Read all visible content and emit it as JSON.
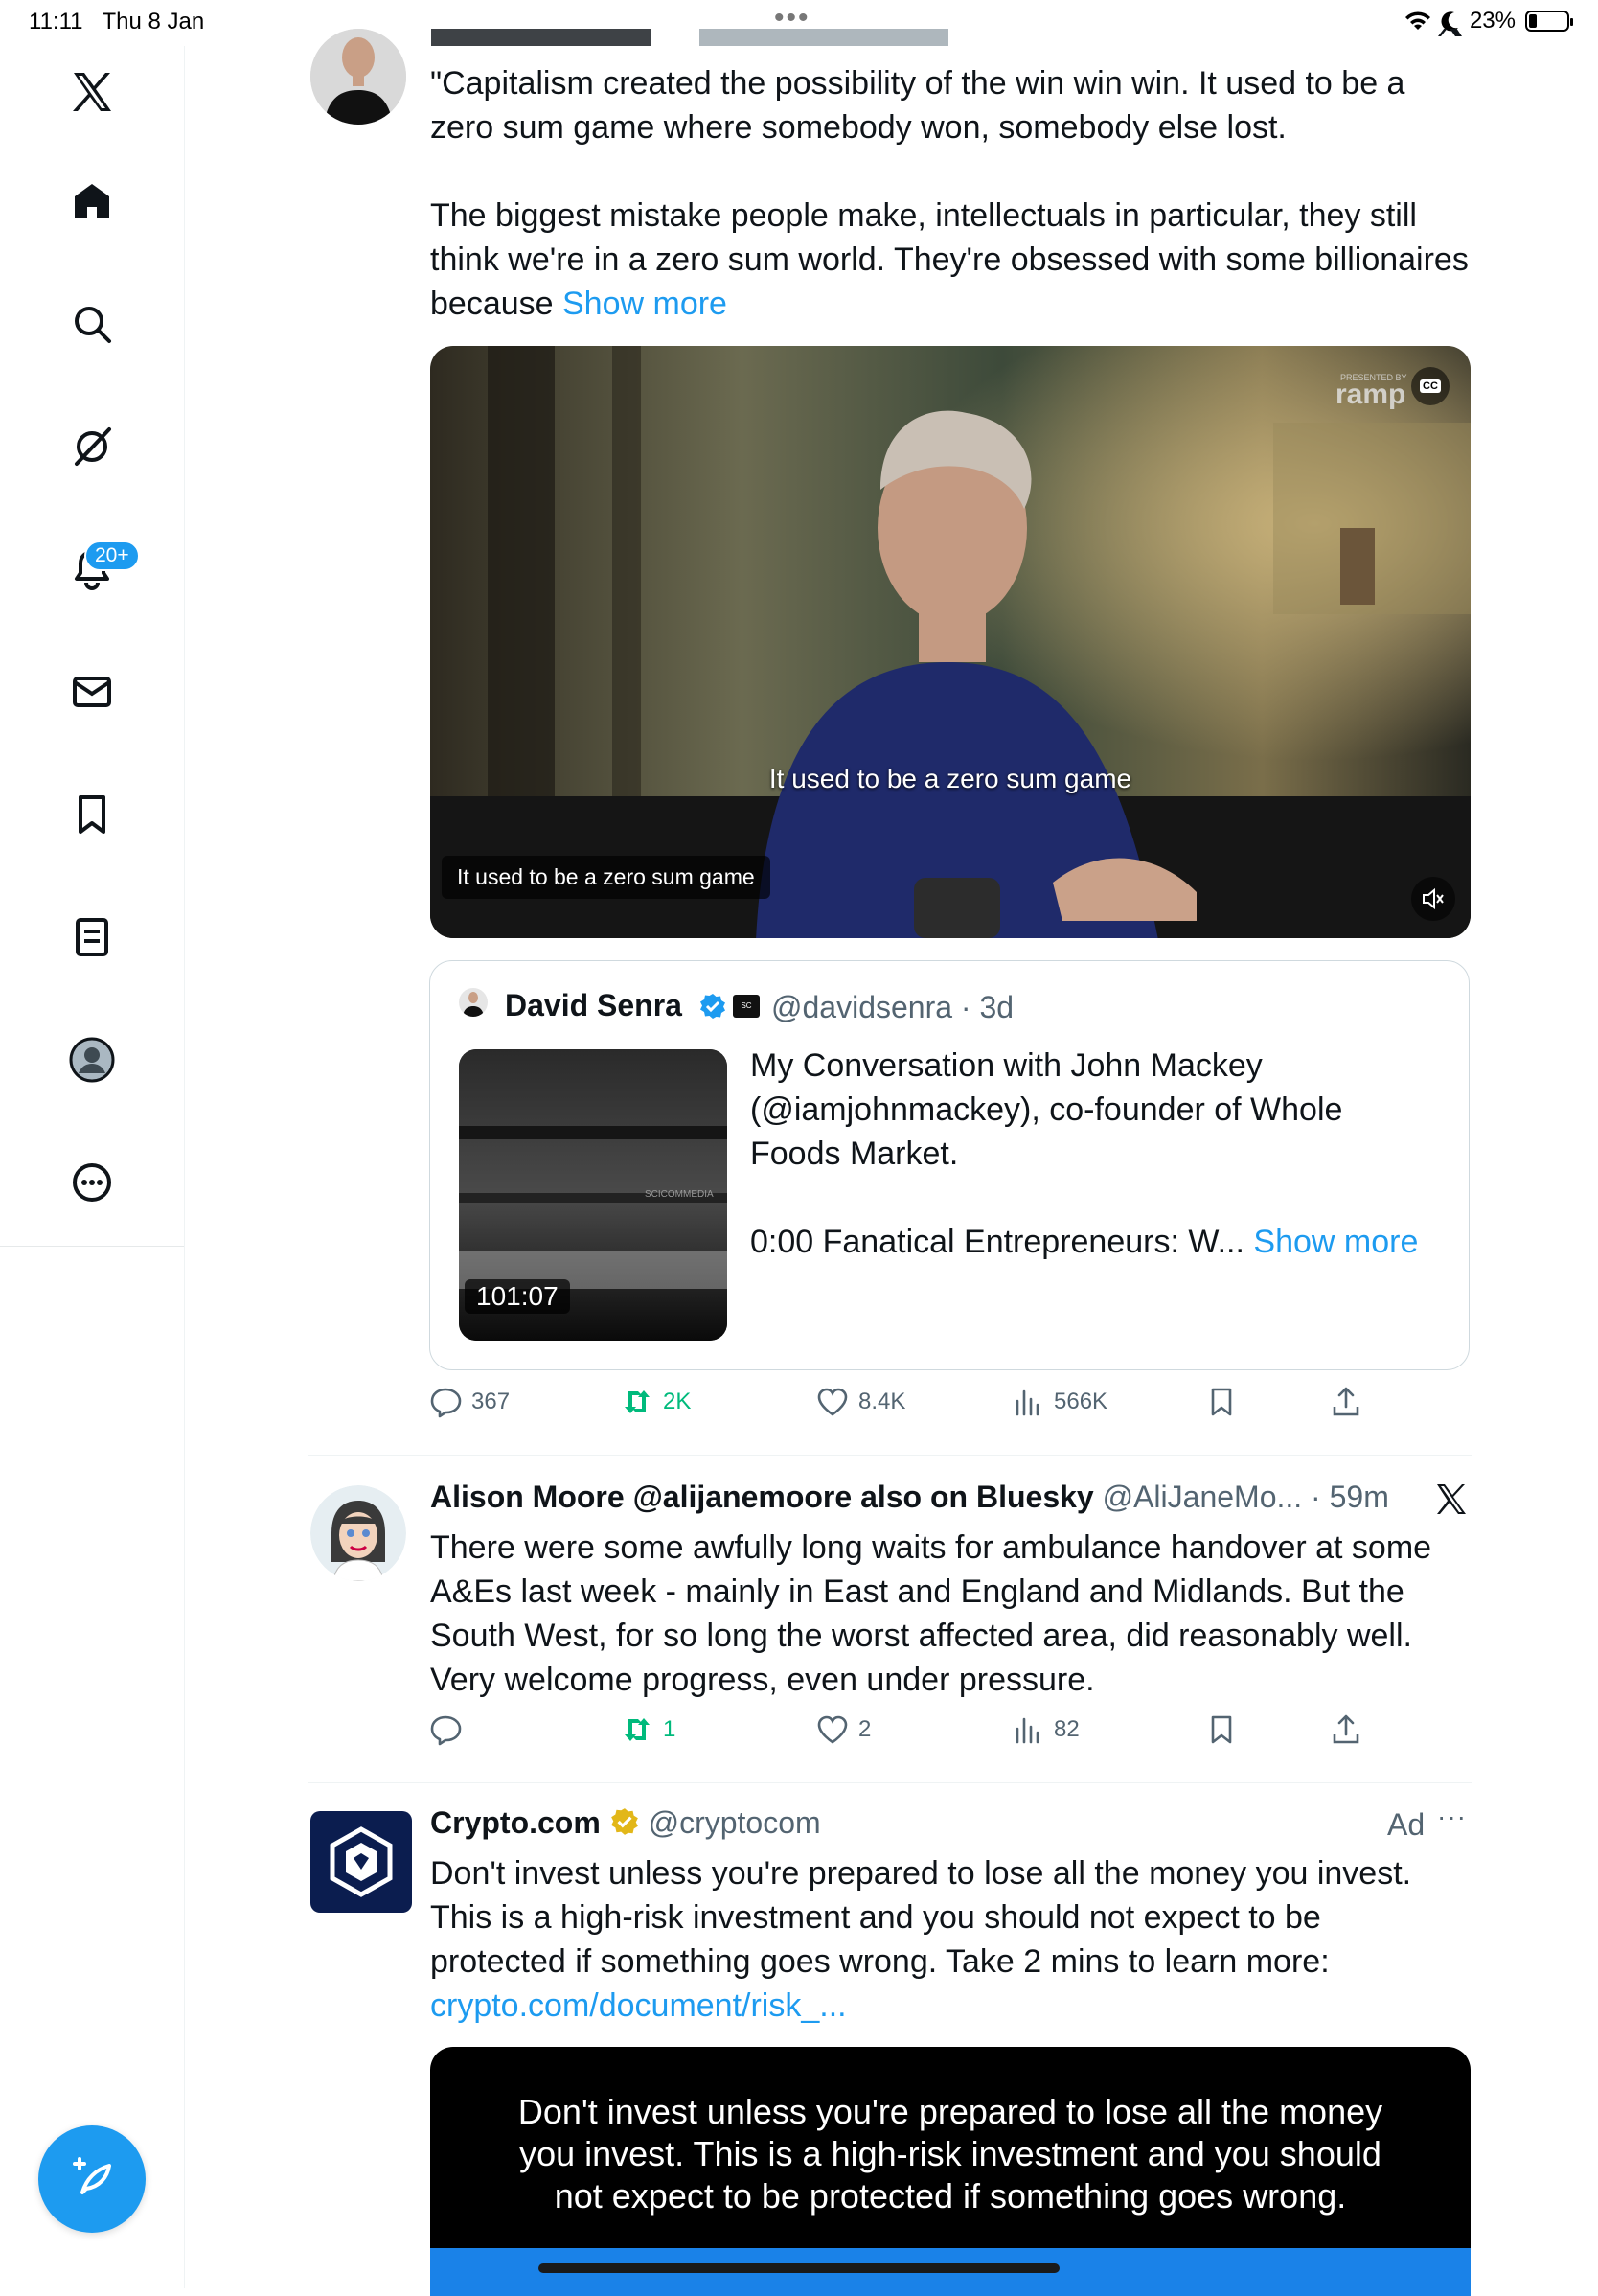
{
  "status_bar": {
    "time": "11:11",
    "date": "Thu 8 Jan",
    "battery": "23%"
  },
  "sidebar": {
    "notifications_badge": "20+",
    "items": [
      "x-logo",
      "home",
      "search",
      "grok",
      "notifications",
      "messages",
      "bookmarks",
      "lists",
      "profile",
      "more"
    ]
  },
  "tweet1": {
    "text_line1": "\"Capitalism created the possibility of the win win win. It used to be a",
    "text_line2": "zero sum game where somebody won, somebody else lost.",
    "text_line3": "The biggest mistake people make, intellectuals in particular, they still",
    "text_line4": "think we're in a zero sum world. They're obsessed with some billionaires",
    "text_line5": "because",
    "show_more": "Show more",
    "video_caption_center": "It used to be a zero sum game",
    "video_caption_box": "It used to be a zero sum game",
    "video_watermark": "ramp",
    "video_watermark_small": "PRESENTED BY",
    "cc_label": "CC",
    "quote": {
      "name": "David Senra",
      "handle": "@davidsenra",
      "age": "3d",
      "duration": "101:07",
      "thumb_text": "SCICOMMEDIA",
      "line1": "My Conversation with John Mackey",
      "line2": "(@iamjohnmackey), co-founder of Whole",
      "line3": "Foods Market.",
      "line4": "0:00 Fanatical Entrepreneurs: W...",
      "show_more": "Show more"
    },
    "stats": {
      "replies": "367",
      "reposts": "2K",
      "likes": "8.4K",
      "views": "566K"
    }
  },
  "tweet2": {
    "name": "Alison Moore @alijanemoore also on Bluesky",
    "handle": "@AliJaneMo...",
    "age": "59m",
    "line1": "There were some awfully long waits for ambulance handover at some",
    "line2": "A&Es last week - mainly in East and England and Midlands. But the",
    "line3": "South West, for so long the worst affected area, did reasonably well.",
    "line4": "Very welcome progress, even under pressure.",
    "stats": {
      "replies": "",
      "reposts": "1",
      "likes": "2",
      "views": "82"
    }
  },
  "tweet3": {
    "name": "Crypto.com",
    "handle": "@cryptocom",
    "ad_label": "Ad",
    "line1": "Don't invest unless you're prepared to lose all the money you invest.",
    "line2": "This is a high-risk investment and you should not expect to be",
    "line3": "protected if something goes wrong. Take 2 mins to learn more:",
    "link": "crypto.com/document/risk_...",
    "media_line1": "Don't invest unless you're prepared to lose all the money",
    "media_line2": "you invest. This is a high-risk investment and you should",
    "media_line3": "not expect to be protected if something goes wrong."
  },
  "colors": {
    "accent": "#1d9bf0",
    "repost_green": "#00ba7c",
    "muted": "#536471",
    "verified_gold": "#e2b719"
  }
}
